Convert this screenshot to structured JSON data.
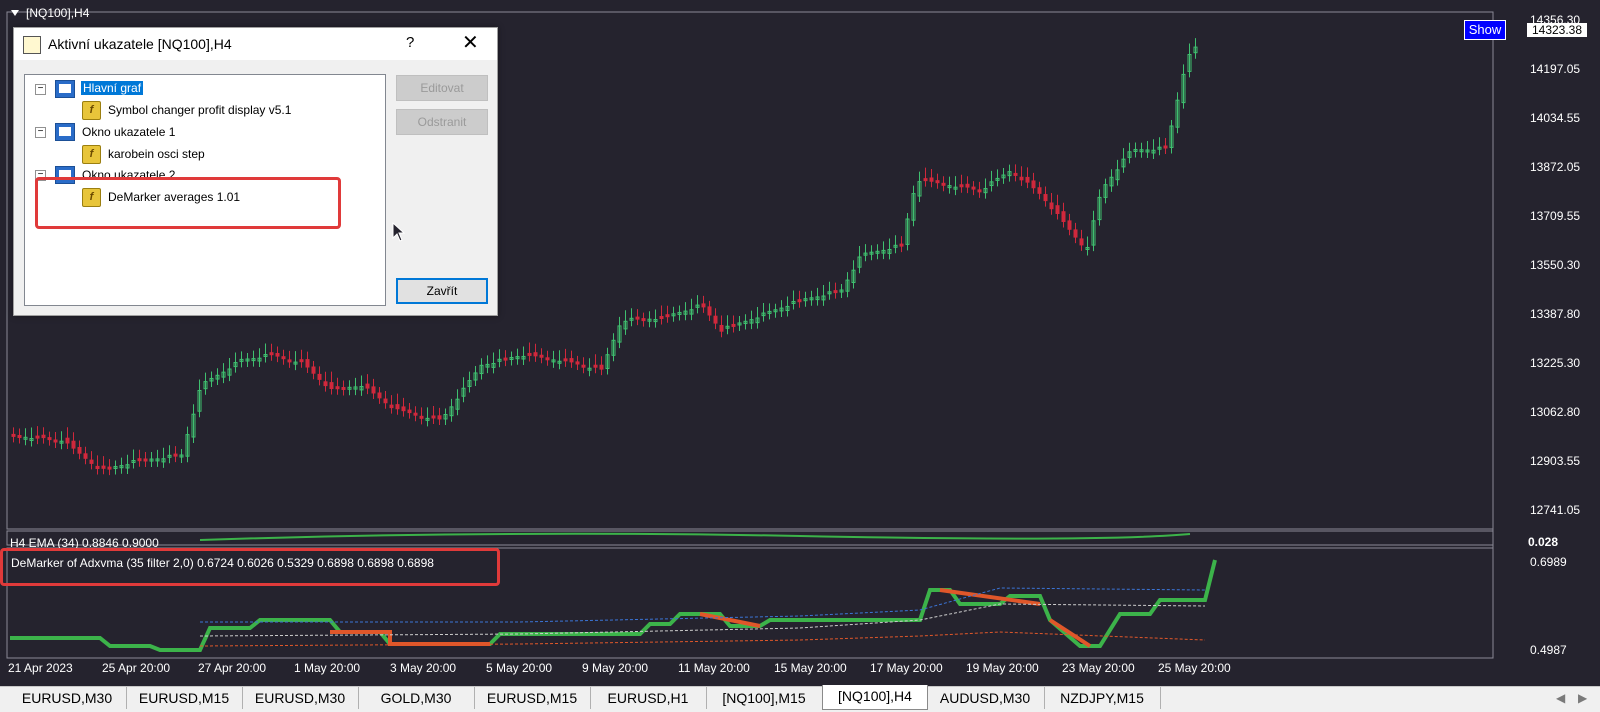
{
  "chart": {
    "symbol_title": "[NQ100],H4",
    "show_label": "Show",
    "current_price": "14323.38",
    "price_axis": [
      "14356.30",
      "14197.05",
      "14034.55",
      "13872.05",
      "13709.55",
      "13550.30",
      "13387.80",
      "13225.30",
      "13062.80",
      "12903.55",
      "12741.05"
    ],
    "time_axis": [
      "21 Apr 2023",
      "25 Apr 20:00",
      "27 Apr 20:00",
      "1 May 20:00",
      "3 May 20:00",
      "5 May 20:00",
      "9 May 20:00",
      "11 May 20:00",
      "15 May 20:00",
      "17 May 20:00",
      "19 May 20:00",
      "23 May 20:00",
      "25 May 20:00"
    ],
    "colors": {
      "background": "#25232e",
      "bull": "#3fbf6f",
      "bear": "#d0283c",
      "green_line": "#3cb34a",
      "orange_line": "#e0572a",
      "blue_dash": "#3b74d6"
    }
  },
  "indicators": {
    "ema_label": "H4 EMA (34) 0.8846 0.9000",
    "ema_axis": "0.028",
    "demarker_label": "DeMarker of Adxvma (35 filter 2,0) 0.6724 0.6026 0.5329 0.6898 0.6898 0.6898",
    "demarker_axis_top": "0.6989",
    "demarker_axis_bottom": "0.4987"
  },
  "dialog": {
    "title": "Aktivní ukazatele [NQ100],H4",
    "help": "?",
    "close": "✕",
    "tree": [
      {
        "label": "Hlavní graf",
        "type": "chart",
        "selected": true
      },
      {
        "label": "Symbol changer profit display v5.1",
        "type": "indicator"
      },
      {
        "label": "Okno ukazatele 1",
        "type": "chart"
      },
      {
        "label": "karobein osci step",
        "type": "indicator"
      },
      {
        "label": "Okno ukazatele 2",
        "type": "chart"
      },
      {
        "label": "DeMarker  averages 1.01",
        "type": "indicator"
      }
    ],
    "edit_button": "Editovat",
    "remove_button": "Odstranit",
    "close_button": "Zavřít"
  },
  "tabs": [
    "EURUSD,M30",
    "EURUSD,M15",
    "EURUSD,M30",
    "GOLD,M30",
    "EURUSD,M15",
    "EURUSD,H1",
    "[NQ100],M15",
    "[NQ100],H4",
    "AUDUSD,M30",
    "NZDJPY,M15"
  ],
  "active_tab": "[NQ100],H4"
}
